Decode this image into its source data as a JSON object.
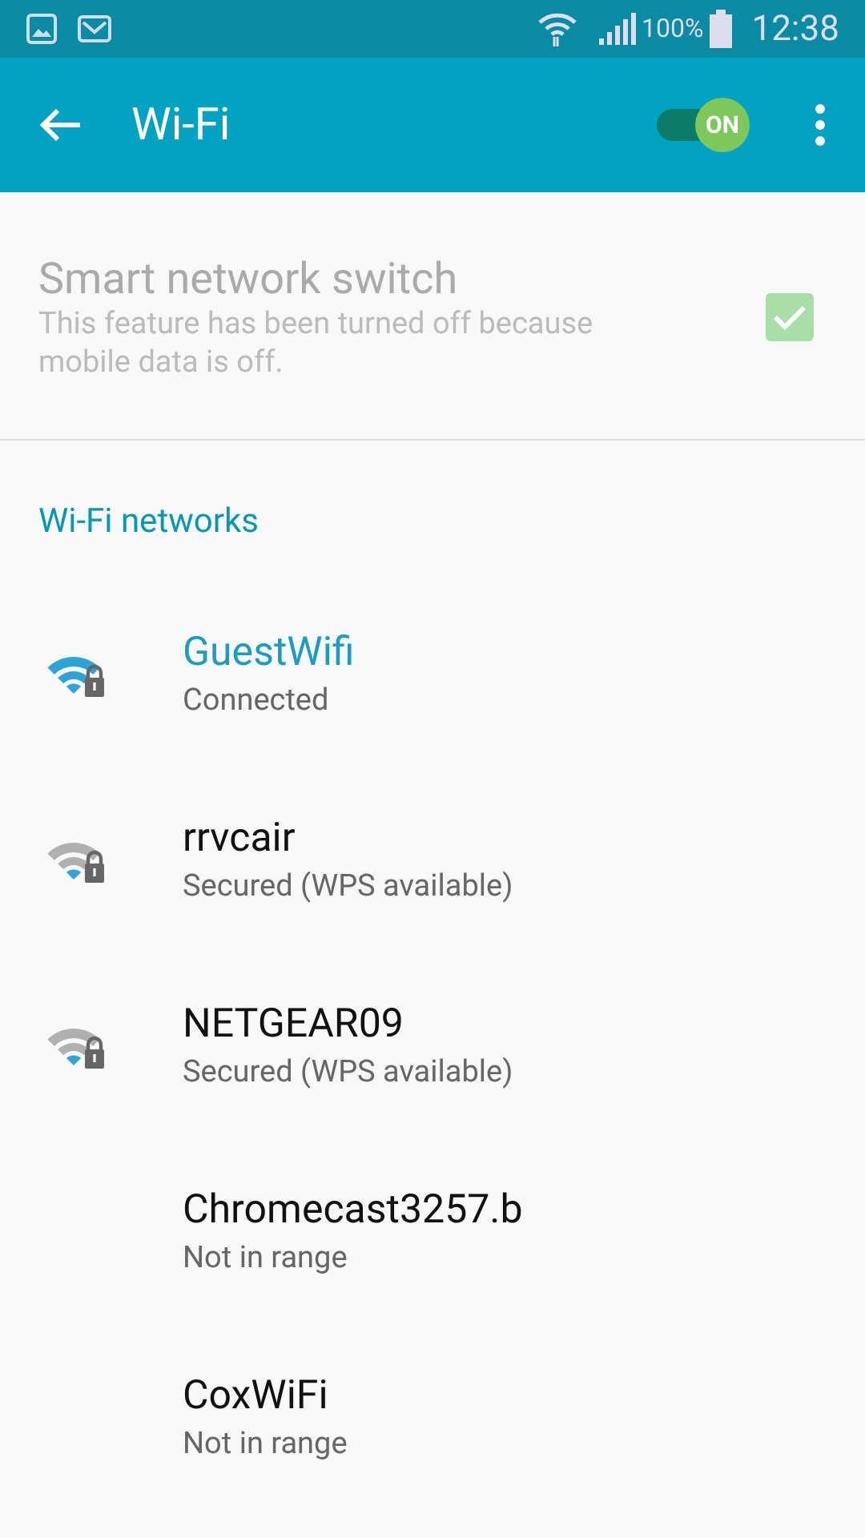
{
  "status_bar": {
    "battery": "100%",
    "time": "12:38"
  },
  "app_bar": {
    "title": "Wi-Fi",
    "toggle": {
      "label": "ON",
      "on": true
    }
  },
  "smart_switch": {
    "title": "Smart network switch",
    "description": "This feature has been turned off because mobile data is off.",
    "checked": true,
    "disabled": true
  },
  "section_title": "Wi-Fi networks",
  "networks": [
    {
      "name": "GuestWifi",
      "status": "Connected",
      "connected": true,
      "kind": "full"
    },
    {
      "name": "rrvcair",
      "status": "Secured (WPS available)",
      "connected": false,
      "kind": "low"
    },
    {
      "name": "NETGEAR09",
      "status": "Secured (WPS available)",
      "connected": false,
      "kind": "low"
    },
    {
      "name": "Chromecast3257.b",
      "status": "Not in range",
      "connected": false,
      "kind": "absent"
    },
    {
      "name": "CoxWiFi",
      "status": "Not in range",
      "connected": false,
      "kind": "absent"
    }
  ]
}
